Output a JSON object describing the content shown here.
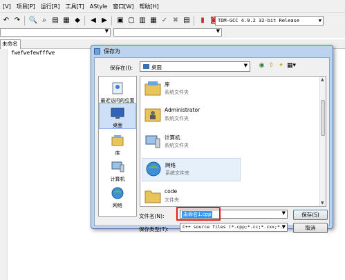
{
  "menubar": [
    "[V]",
    "项目[P]",
    "运行[R]",
    "工具[T]",
    "AStyle",
    "窗口[W]",
    "帮助[H]"
  ],
  "toolbar": {
    "compiler": "TDM-GCC 4.9.2 32-bit Release"
  },
  "editor": {
    "tab": "未命名1",
    "line1": "fwefwefewfffwe"
  },
  "dialog": {
    "title": "保存为",
    "save_in_label": "保存在(I):",
    "save_in_value": "桌面",
    "places": [
      {
        "label": "最近访问的位置",
        "icon": "recent-icon"
      },
      {
        "label": "桌面",
        "icon": "desktop-icon"
      },
      {
        "label": "库",
        "icon": "library-icon"
      },
      {
        "label": "计算机",
        "icon": "computer-icon"
      },
      {
        "label": "网络",
        "icon": "network-icon"
      }
    ],
    "files": [
      {
        "name": "库",
        "type": "系统文件夹"
      },
      {
        "name": "Administrator",
        "type": "系统文件夹"
      },
      {
        "name": "计算机",
        "type": "系统文件夹"
      },
      {
        "name": "网络",
        "type": "系统文件夹"
      },
      {
        "name": "code",
        "type": "文件夹"
      }
    ],
    "filename_label": "文件名(N):",
    "filename_value": "未命名1.cpp",
    "filetype_label": "保存类型(T):",
    "filetype_value": "C++ source files (*.cpp;*.cc;*.cxx;*.",
    "save_button": "保存(S)",
    "cancel_button": "取消"
  }
}
